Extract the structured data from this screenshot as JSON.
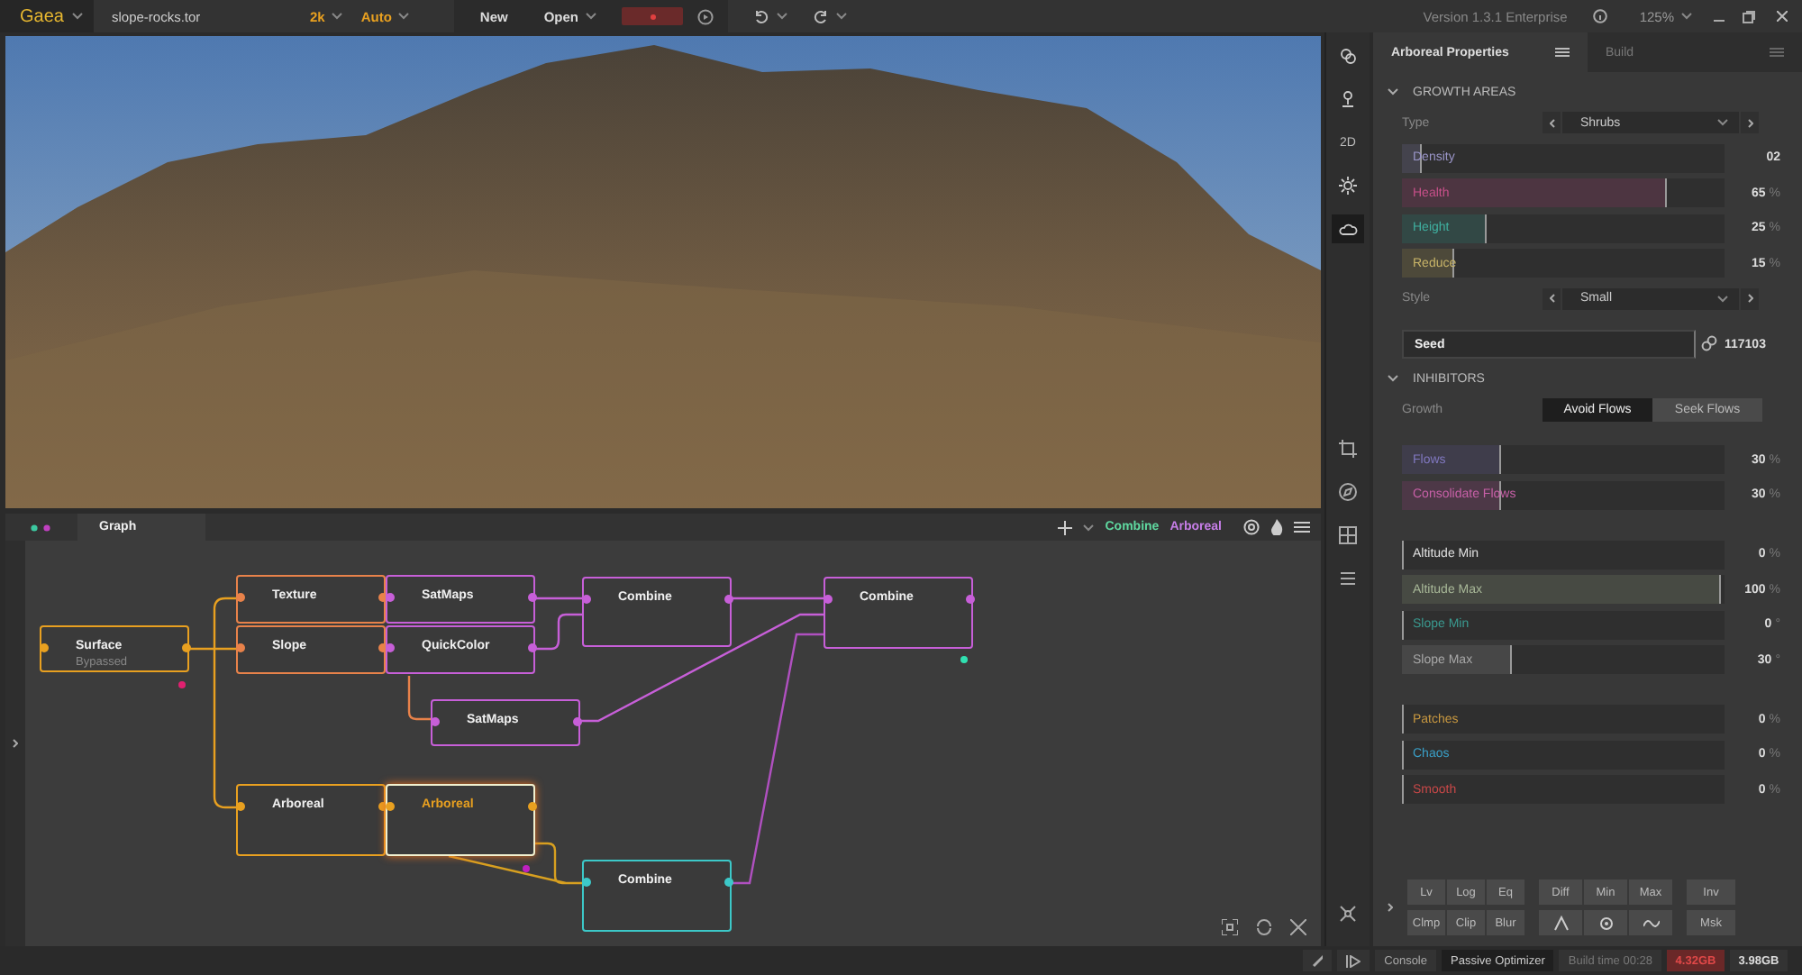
{
  "top_bar": {
    "app_name": "Gaea",
    "file_name": "slope-rocks.tor",
    "resolution": "2k",
    "build_mode": "Auto",
    "file_buttons": [
      "New",
      "Open"
    ],
    "version": "Version 1.3.1 Enterprise",
    "zoom": "125%"
  },
  "side_toolbar": {
    "tools": [
      {
        "kind": "icon",
        "selected": false
      },
      {
        "kind": "icon",
        "selected": false
      },
      {
        "kind": "text",
        "label": "2D",
        "selected": false
      },
      {
        "kind": "icon",
        "selected": false
      },
      {
        "kind": "icon",
        "selected": true
      }
    ]
  },
  "graph": {
    "tab": "Graph",
    "toolbar_labels": [
      {
        "label": "Combine",
        "color": "#5fd9a0"
      },
      {
        "label": "Arboreal",
        "color": "#c77ee8"
      }
    ],
    "nodes": [
      {
        "title": "Surface",
        "subtitle": "Bypassed",
        "color": "#e8a020",
        "selected": false
      },
      {
        "title": "Texture",
        "color": "#e8824a",
        "selected": false
      },
      {
        "title": "Slope",
        "color": "#e8824a",
        "selected": false
      },
      {
        "title": "SatMaps",
        "color": "#c75fd8",
        "selected": false
      },
      {
        "title": "QuickColor",
        "color": "#c75fd8",
        "selected": false
      },
      {
        "title": "Combine",
        "color": "#c75fd8",
        "selected": false
      },
      {
        "title": "Combine",
        "color": "#c75fd8",
        "selected": false
      },
      {
        "title": "SatMaps",
        "color": "#c75fd8",
        "selected": false
      },
      {
        "title": "Arboreal",
        "color": "#e8a020",
        "selected": false
      },
      {
        "title": "Arboreal",
        "color": "#e8a020",
        "selected": true
      },
      {
        "title": "Combine",
        "color": "#3cc8c8",
        "selected": false
      }
    ]
  },
  "properties": {
    "tabs": [
      {
        "label": "Arboreal Properties",
        "selected": true
      },
      {
        "label": "Build",
        "selected": false
      }
    ],
    "sections": [
      {
        "title": "GROWTH AREAS",
        "expanded": true,
        "rows": [
          {
            "kind": "dropdown",
            "label": "Type",
            "value": "Shrubs"
          },
          {
            "kind": "slider",
            "label": "Density",
            "value": "02",
            "level": 0.06,
            "color": "#9a95c8"
          },
          {
            "kind": "slider",
            "label": "Health",
            "value": "65",
            "unit": "%",
            "level": 0.82,
            "color": "#c8508a"
          },
          {
            "kind": "slider",
            "label": "Height",
            "value": "25",
            "unit": "%",
            "level": 0.26,
            "color": "#3fb0a0"
          },
          {
            "kind": "slider",
            "label": "Reduce",
            "value": "15",
            "unit": "%",
            "level": 0.16,
            "color": "#c8b468"
          },
          {
            "kind": "dropdown",
            "label": "Style",
            "value": "Small"
          },
          {
            "kind": "seed",
            "label": "Seed",
            "value": "117103"
          }
        ]
      },
      {
        "title": "INHIBITORS",
        "expanded": true,
        "rows": [
          {
            "kind": "toggle",
            "label": "Growth",
            "options": [
              {
                "label": "Avoid Flows",
                "selected": true
              },
              {
                "label": "Seek Flows",
                "selected": false
              }
            ]
          },
          {
            "kind": "slider",
            "label": "Flows",
            "value": "30",
            "unit": "%",
            "level": 0.31,
            "color": "#8078c0"
          },
          {
            "kind": "slider",
            "label": "Consolidate Flows",
            "value": "30",
            "unit": "%",
            "level": 0.31,
            "color": "#c860a8"
          },
          {
            "kind": "spacer"
          },
          {
            "kind": "slider",
            "label": "Altitude Min",
            "value": "0",
            "unit": "%",
            "level": 0,
            "color": "#e0e0e0"
          },
          {
            "kind": "slider",
            "label": "Altitude Max",
            "value": "100",
            "unit": "%",
            "level": 0.99,
            "color": "#a8b898"
          },
          {
            "kind": "slider",
            "label": "Slope Min",
            "value": "0",
            "unit": "°",
            "level": 0,
            "color": "#3a9a90"
          },
          {
            "kind": "slider",
            "label": "Slope Max",
            "value": "30",
            "unit": "°",
            "level": 0.34,
            "color": "#a8a8a8"
          },
          {
            "kind": "spacer"
          },
          {
            "kind": "slider",
            "label": "Patches",
            "value": "0",
            "unit": "%",
            "level": 0,
            "color": "#c89840"
          },
          {
            "kind": "slider",
            "label": "Chaos",
            "value": "0",
            "unit": "%",
            "level": 0,
            "color": "#3aa0c8"
          },
          {
            "kind": "slider",
            "label": "Smooth",
            "value": "0",
            "unit": "%",
            "level": 0,
            "color": "#c84848"
          }
        ]
      }
    ]
  },
  "tool_buttons": [
    [
      {
        "kind": "text",
        "label": "Lv"
      },
      {
        "kind": "text",
        "label": "Log"
      },
      {
        "kind": "text",
        "label": "Eq"
      },
      {
        "kind": "text",
        "label": "Diff"
      },
      {
        "kind": "text",
        "label": "Min"
      },
      {
        "kind": "text",
        "label": "Max"
      },
      {
        "kind": "text",
        "label": "Inv"
      }
    ],
    [
      {
        "kind": "text",
        "label": "Clmp"
      },
      {
        "kind": "text",
        "label": "Clip"
      },
      {
        "kind": "text",
        "label": "Blur"
      },
      {
        "kind": "peak"
      },
      {
        "kind": "target"
      },
      {
        "kind": "wave"
      },
      {
        "kind": "text",
        "label": "Msk"
      }
    ]
  ],
  "status_bar": {
    "console": "Console",
    "optimizer": "Passive Optimizer",
    "build_time": "Build time 00:28",
    "memory": [
      {
        "label": "4.32GB",
        "warning": true
      },
      {
        "label": "3.98GB",
        "warning": false
      }
    ]
  }
}
